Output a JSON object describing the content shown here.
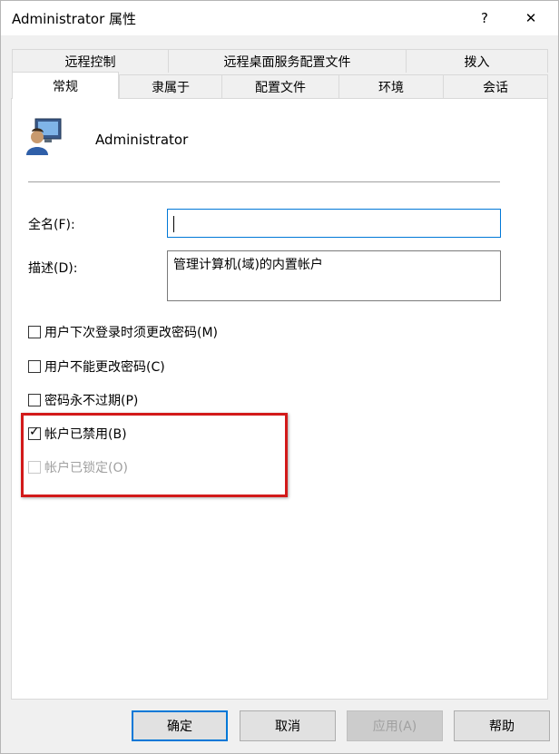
{
  "window": {
    "title": "Administrator 属性",
    "help_label": "?",
    "close_label": "✕"
  },
  "tabs": {
    "row1": [
      "远程控制",
      "远程桌面服务配置文件",
      "拨入"
    ],
    "row2": [
      "常规",
      "隶属于",
      "配置文件",
      "环境",
      "会话"
    ],
    "active": "常规"
  },
  "user": {
    "name": "Administrator",
    "icon": "user-account-icon"
  },
  "form": {
    "fullname_label": "全名(F):",
    "fullname_value": "",
    "description_label": "描述(D):",
    "description_value": "管理计算机(域)的内置帐户"
  },
  "checkboxes": [
    {
      "label": "用户下次登录时须更改密码(M)",
      "checked": false,
      "enabled": true
    },
    {
      "label": "用户不能更改密码(C)",
      "checked": false,
      "enabled": true
    },
    {
      "label": "密码永不过期(P)",
      "checked": false,
      "enabled": true
    },
    {
      "label": "帐户已禁用(B)",
      "checked": true,
      "enabled": true
    },
    {
      "label": "帐户已锁定(O)",
      "checked": false,
      "enabled": false
    }
  ],
  "buttons": {
    "ok": "确定",
    "cancel": "取消",
    "apply": "应用(A)",
    "help": "帮助"
  },
  "colors": {
    "highlight": "#d21a1a",
    "focus": "#0078d7"
  }
}
